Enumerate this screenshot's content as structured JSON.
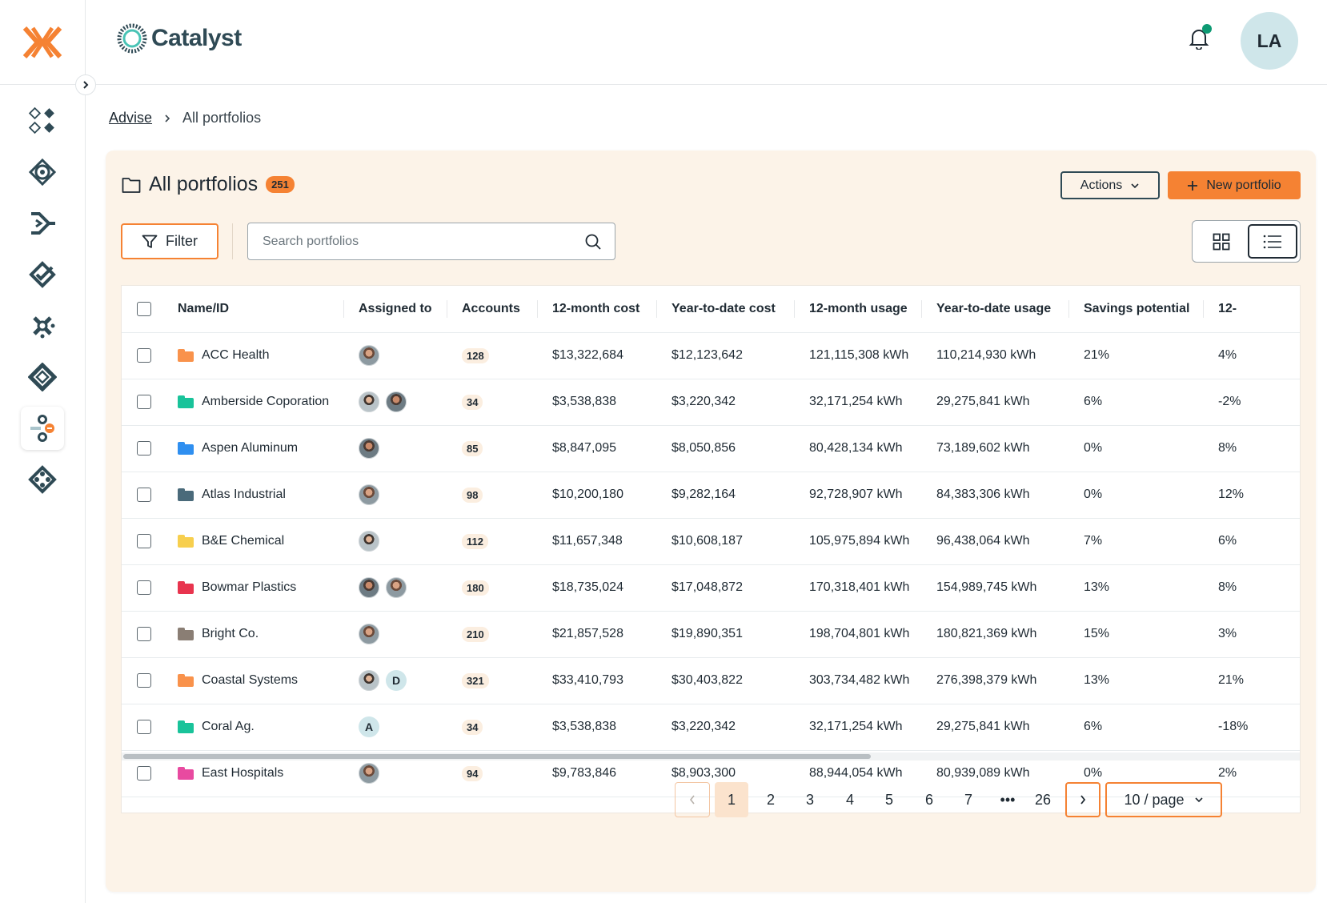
{
  "app": {
    "brand": "Catalyst",
    "user_initials": "LA"
  },
  "breadcrumb": {
    "parent": "Advise",
    "current": "All portfolios"
  },
  "panel": {
    "title": "All portfolios",
    "count": "251",
    "actions_label": "Actions",
    "new_label": "New portfolio",
    "filter_label": "Filter",
    "search_placeholder": "Search portfolios"
  },
  "table": {
    "columns": [
      "Name/ID",
      "Assigned to",
      "Accounts",
      "12-month cost",
      "Year-to-date cost",
      "12-month usage",
      "Year-to-date usage",
      "Savings potential",
      "12-"
    ],
    "rows": [
      {
        "name": "ACC Health",
        "folder_color": "#f9924b",
        "assignees": [
          "face"
        ],
        "accounts": "128",
        "cost12": "$13,322,684",
        "ytdcost": "$12,123,642",
        "usage12": "121,115,308 kWh",
        "ytdusage": "110,214,930 kWh",
        "savings": "21%",
        "extra": "4%"
      },
      {
        "name": "Amberside Coporation",
        "folder_color": "#19c39a",
        "assignees": [
          "face",
          "face"
        ],
        "accounts": "34",
        "cost12": "$3,538,838",
        "ytdcost": "$3,220,342",
        "usage12": "32,171,254 kWh",
        "ytdusage": "29,275,841 kWh",
        "savings": "6%",
        "extra": "-2%"
      },
      {
        "name": "Aspen Aluminum",
        "folder_color": "#2f8ff0",
        "assignees": [
          "face"
        ],
        "accounts": "85",
        "cost12": "$8,847,095",
        "ytdcost": "$8,050,856",
        "usage12": "80,428,134 kWh",
        "ytdusage": "73,189,602 kWh",
        "savings": "0%",
        "extra": "8%"
      },
      {
        "name": "Atlas Industrial",
        "folder_color": "#4a6a7a",
        "assignees": [
          "face"
        ],
        "accounts": "98",
        "cost12": "$10,200,180",
        "ytdcost": "$9,282,164",
        "usage12": "92,728,907 kWh",
        "ytdusage": "84,383,306 kWh",
        "savings": "0%",
        "extra": "12%"
      },
      {
        "name": "B&E Chemical",
        "folder_color": "#f7cf4e",
        "assignees": [
          "face"
        ],
        "accounts": "112",
        "cost12": "$11,657,348",
        "ytdcost": "$10,608,187",
        "usage12": "105,975,894 kWh",
        "ytdusage": "96,438,064 kWh",
        "savings": "7%",
        "extra": "6%"
      },
      {
        "name": "Bowmar Plastics",
        "folder_color": "#e8344e",
        "assignees": [
          "face",
          "face"
        ],
        "accounts": "180",
        "cost12": "$18,735,024",
        "ytdcost": "$17,048,872",
        "usage12": "170,318,401 kWh",
        "ytdusage": "154,989,745 kWh",
        "savings": "13%",
        "extra": "8%"
      },
      {
        "name": "Bright Co.",
        "folder_color": "#8a7e74",
        "assignees": [
          "face"
        ],
        "accounts": "210",
        "cost12": "$21,857,528",
        "ytdcost": "$19,890,351",
        "usage12": "198,704,801 kWh",
        "ytdusage": "180,821,369 kWh",
        "savings": "15%",
        "extra": "3%"
      },
      {
        "name": "Coastal Systems",
        "folder_color": "#f9924b",
        "assignees": [
          "face",
          "D"
        ],
        "accounts": "321",
        "cost12": "$33,410,793",
        "ytdcost": "$30,403,822",
        "usage12": "303,734,482 kWh",
        "ytdusage": "276,398,379 kWh",
        "savings": "13%",
        "extra": "21%"
      },
      {
        "name": "Coral Ag.",
        "folder_color": "#19c39a",
        "assignees": [
          "A"
        ],
        "accounts": "34",
        "cost12": "$3,538,838",
        "ytdcost": "$3,220,342",
        "usage12": "32,171,254 kWh",
        "ytdusage": "29,275,841 kWh",
        "savings": "6%",
        "extra": "-18%"
      },
      {
        "name": "East Hospitals",
        "folder_color": "#e84aa0",
        "assignees": [
          "face"
        ],
        "accounts": "94",
        "cost12": "$9,783,846",
        "ytdcost": "$8,903,300",
        "usage12": "88,944,054 kWh",
        "ytdusage": "80,939,089 kWh",
        "savings": "0%",
        "extra": "2%"
      }
    ]
  },
  "pagination": {
    "pages": [
      "1",
      "2",
      "3",
      "4",
      "5",
      "6",
      "7",
      "•••",
      "26"
    ],
    "current": "1",
    "page_size": "10 / page"
  },
  "colors": {
    "accent": "#f58233",
    "panel_bg": "#fcf3e8",
    "dark": "#2f4a55",
    "notification": "#0d9a73"
  }
}
